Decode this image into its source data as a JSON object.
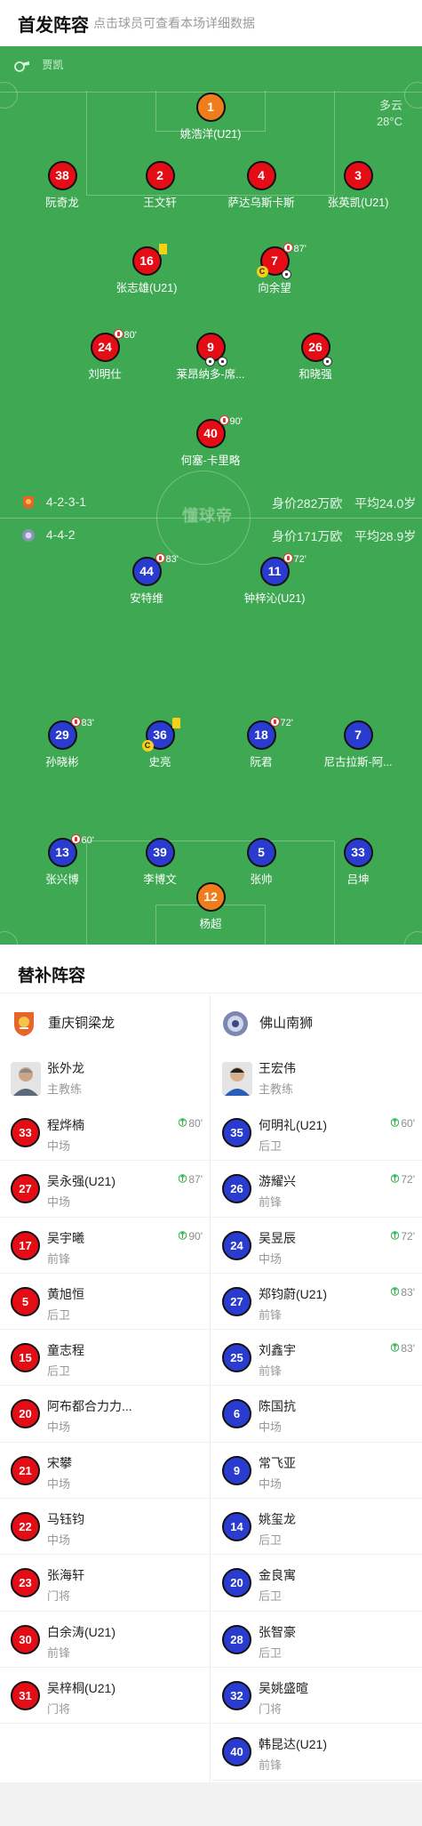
{
  "header": {
    "title": "首发阵容",
    "subtitle": "点击球员可查看本场详细数据"
  },
  "referee": {
    "name": "贾凯"
  },
  "weather": {
    "condition": "多云",
    "temperature": "28°C"
  },
  "home_team": {
    "formation": "4-2-3-1",
    "value": "身价282万欧",
    "avg_age": "平均24.0岁"
  },
  "away_team": {
    "formation": "4-4-2",
    "value": "身价171万欧",
    "avg_age": "平均28.9岁"
  },
  "watermark": "懂球帝",
  "pitch_players": [
    {
      "num": "1",
      "name": "姚浩洋(U21)"
    },
    {
      "num": "38",
      "name": "阮奇龙"
    },
    {
      "num": "2",
      "name": "王文轩"
    },
    {
      "num": "4",
      "name": "萨达乌斯卡斯"
    },
    {
      "num": "3",
      "name": "张英凯(U21)"
    },
    {
      "num": "16",
      "name": "张志雄(U21)"
    },
    {
      "num": "7",
      "name": "向余望",
      "sub_time": "87'"
    },
    {
      "num": "24",
      "name": "刘明仕",
      "sub_time": "80'"
    },
    {
      "num": "9",
      "name": "莱昂纳多-席..."
    },
    {
      "num": "26",
      "name": "和晓强"
    },
    {
      "num": "40",
      "name": "何塞-卡里略",
      "sub_time": "90'"
    },
    {
      "num": "44",
      "name": "安特维",
      "sub_time": "83'"
    },
    {
      "num": "11",
      "name": "钟梓沁(U21)",
      "sub_time": "72'"
    },
    {
      "num": "29",
      "name": "孙晓彬",
      "sub_time": "83'"
    },
    {
      "num": "36",
      "name": "史亮"
    },
    {
      "num": "18",
      "name": "阮君",
      "sub_time": "72'"
    },
    {
      "num": "7",
      "name": "尼古拉斯-阿..."
    },
    {
      "num": "13",
      "name": "张兴博",
      "sub_time": "60'"
    },
    {
      "num": "39",
      "name": "李博文"
    },
    {
      "num": "5",
      "name": "张帅"
    },
    {
      "num": "33",
      "name": "吕坤"
    },
    {
      "num": "12",
      "name": "杨超"
    }
  ],
  "subs": {
    "title": "替补阵容",
    "home": {
      "team": "重庆铜梁龙",
      "coach": {
        "name": "张外龙",
        "role": "主教练"
      },
      "players": [
        {
          "num": "33",
          "name": "程烨楠",
          "pos": "中场",
          "sub": "80'"
        },
        {
          "num": "27",
          "name": "吴永强(U21)",
          "pos": "中场",
          "sub": "87'"
        },
        {
          "num": "17",
          "name": "吴宇曦",
          "pos": "前锋",
          "sub": "90'"
        },
        {
          "num": "5",
          "name": "黄旭恒",
          "pos": "后卫"
        },
        {
          "num": "15",
          "name": "童志程",
          "pos": "后卫"
        },
        {
          "num": "20",
          "name": "阿布都合力力...",
          "pos": "中场"
        },
        {
          "num": "21",
          "name": "宋攀",
          "pos": "中场"
        },
        {
          "num": "22",
          "name": "马钰钧",
          "pos": "中场"
        },
        {
          "num": "23",
          "name": "张海轩",
          "pos": "门将"
        },
        {
          "num": "30",
          "name": "白余涛(U21)",
          "pos": "前锋"
        },
        {
          "num": "31",
          "name": "吴梓桐(U21)",
          "pos": "门将"
        }
      ]
    },
    "away": {
      "team": "佛山南狮",
      "coach": {
        "name": "王宏伟",
        "role": "主教练"
      },
      "players": [
        {
          "num": "35",
          "name": "何明礼(U21)",
          "pos": "后卫",
          "sub": "60'"
        },
        {
          "num": "26",
          "name": "游耀兴",
          "pos": "前锋",
          "sub": "72'"
        },
        {
          "num": "24",
          "name": "吴昱辰",
          "pos": "中场",
          "sub": "72'"
        },
        {
          "num": "27",
          "name": "郑钧蔚(U21)",
          "pos": "前锋",
          "sub": "83'"
        },
        {
          "num": "25",
          "name": "刘鑫宇",
          "pos": "前锋",
          "sub": "83'"
        },
        {
          "num": "6",
          "name": "陈国抗",
          "pos": "中场"
        },
        {
          "num": "9",
          "name": "常飞亚",
          "pos": "中场"
        },
        {
          "num": "14",
          "name": "姚玺龙",
          "pos": "后卫"
        },
        {
          "num": "20",
          "name": "金良寓",
          "pos": "后卫"
        },
        {
          "num": "28",
          "name": "张智豪",
          "pos": "后卫"
        },
        {
          "num": "32",
          "name": "吴姚盛暄",
          "pos": "门将"
        },
        {
          "num": "40",
          "name": "韩昆达(U21)",
          "pos": "前锋"
        }
      ]
    }
  },
  "colors": {
    "pitch": "#3fa852",
    "home": "#e50d15",
    "away": "#2a3ccf",
    "goalkeeper": "#ef7d1c",
    "yellow_card": "#f7d117"
  }
}
